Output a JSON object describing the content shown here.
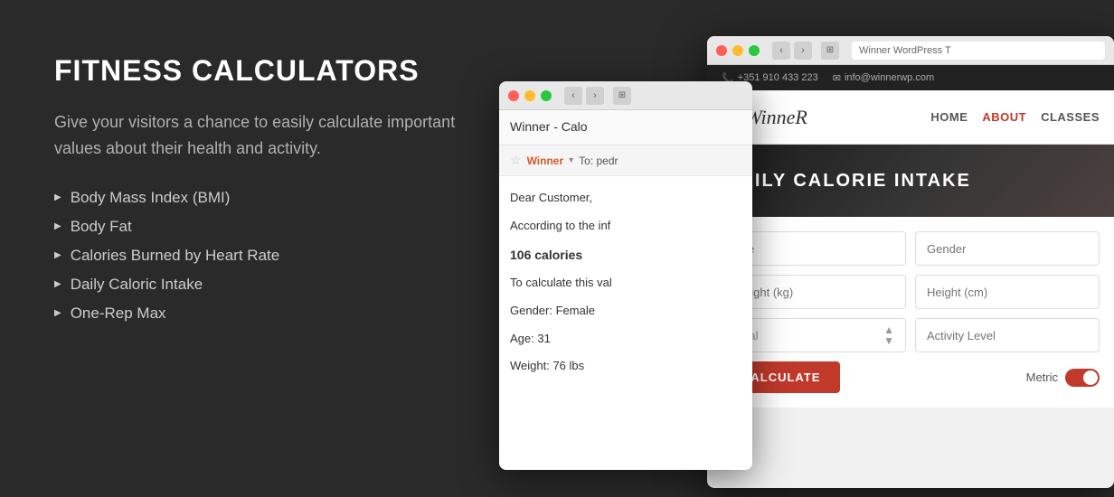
{
  "left": {
    "title": "FITNESS CALCULATORS",
    "description": "Give your visitors a chance to easily calculate important values about their health and activity.",
    "features": [
      "Body Mass Index (BMI)",
      "Body Fat",
      "Calories Burned by Heart Rate",
      "Daily Caloric Intake",
      "One-Rep Max"
    ]
  },
  "email_window": {
    "tab_title": "Winner - Calo",
    "from_label": "Winner",
    "to_label": "To: pedr",
    "body_greeting": "Dear Customer,",
    "body_para1": "According to the inf",
    "calories": "106 calories",
    "body_para2": "To calculate this val",
    "gender_line": "Gender: Female",
    "age_line": "Age: 31",
    "weight_line": "Weight: 76 lbs"
  },
  "main_window": {
    "url": "Winner WordPress T",
    "topbar_phone": "+351 910 433 223",
    "topbar_email": "info@winnerwp.com",
    "logo": "WinneR",
    "nav": {
      "home": "HOME",
      "about": "ABOUT",
      "classes": "CLASSES"
    },
    "hero_title": "DAILY CALORIE INTAKE",
    "form": {
      "age_placeholder": "Age",
      "gender_placeholder": "Gender",
      "weight_placeholder": "Weight (kg)",
      "height_placeholder": "Height (cm)",
      "goal_placeholder": "Goal",
      "activity_placeholder": "Activity Level",
      "calculate_btn": "CALCULATE",
      "metric_label": "Metric"
    }
  }
}
